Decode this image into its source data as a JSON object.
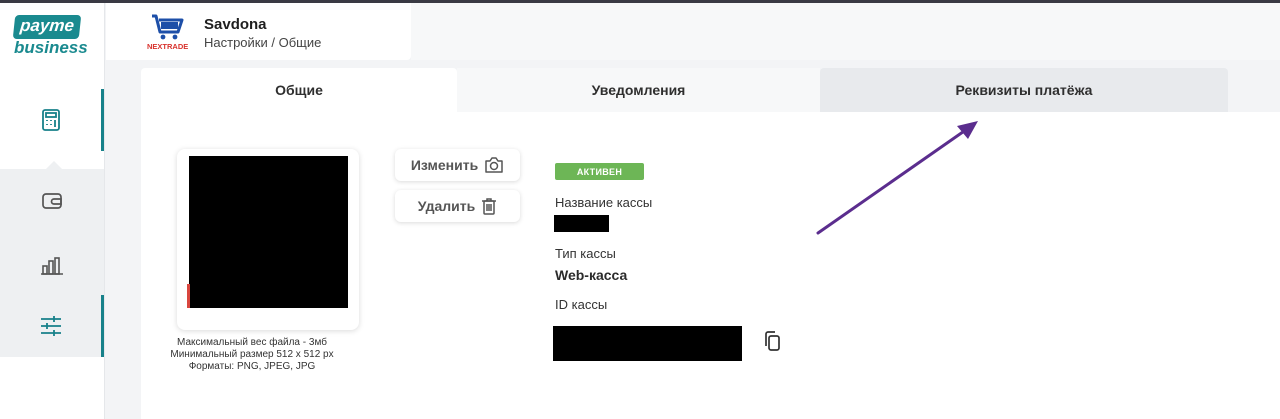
{
  "brand": {
    "logo_top": "payme",
    "logo_bottom": "business",
    "accent_color": "#17818a"
  },
  "sidebar": {
    "items": [
      {
        "icon": "calculator-icon",
        "active": true
      },
      {
        "icon": "wallet-icon",
        "active": false
      },
      {
        "icon": "bar-chart-icon",
        "active": false
      },
      {
        "icon": "sliders-icon",
        "active": true
      }
    ]
  },
  "header": {
    "merchant_name": "Savdona",
    "breadcrumb": "Настройки / Общие",
    "merchant_logo_text": "NEXTRADE"
  },
  "tabs": [
    {
      "label": "Общие",
      "selected": true
    },
    {
      "label": "Уведомления",
      "selected": false
    },
    {
      "label": "Реквизиты платёжа",
      "selected": false
    }
  ],
  "avatar": {
    "hint_lines": [
      "Максимальный вес файла - 3мб",
      "Минимальный размер 512 x 512 px",
      "Форматы: PNG, JPEG, JPG"
    ]
  },
  "actions": {
    "change_label": "Изменить",
    "delete_label": "Удалить"
  },
  "cashbox": {
    "status": "АКТИВЕН",
    "status_color": "#6db656",
    "name_label": "Название кассы",
    "type_label": "Тип кассы",
    "type_value": "Web-касса",
    "id_label": "ID кассы"
  },
  "annotation": {
    "arrow_color": "#5b2d8e"
  }
}
